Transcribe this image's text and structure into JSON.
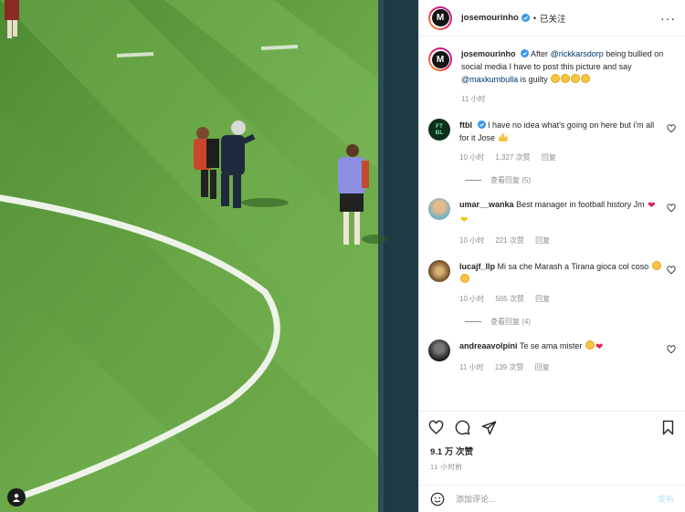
{
  "header": {
    "username": "josemourinho",
    "separator": "•",
    "follow_state": "已关注",
    "more": "···"
  },
  "caption": {
    "username": "josemourinho",
    "text_before": " After ",
    "mention1": "@rickkarsdorp",
    "text_middle": " being bullied on social media I have to post this picture and say ",
    "mention2": "@maxkumbulla",
    "text_after": " is guilty",
    "time": "11 小时"
  },
  "comments": [
    {
      "username": "ftbl",
      "verified": true,
      "avatar_text": "FT BL",
      "text": "I have no idea what's going on here but i'm all for it Jose",
      "time": "10 小时",
      "likes": "1,327 次赞",
      "reply": "回复",
      "view_replies": "查看回复 (5)"
    },
    {
      "username": "umar__wanka",
      "text": "Best manager in football history Jm",
      "time": "10 小时",
      "likes": "221 次赞",
      "reply": "回复"
    },
    {
      "username": "lucajf_llp",
      "text": "Mi sa che Marash a Tirana gioca col coso",
      "time": "10 小时",
      "likes": "505 次赞",
      "reply": "回复",
      "view_replies": "查看回复 (4)"
    },
    {
      "username": "andreaavolpini",
      "text": "Te se ama mister",
      "time": "11 小时",
      "likes": "139 次赞",
      "reply": "回复"
    }
  ],
  "actions": {
    "like_icon": "heart-icon",
    "comment_icon": "comment-icon",
    "share_icon": "share-icon",
    "save_icon": "bookmark-icon",
    "likes_count": "9.1 万 次赞",
    "posted": "11 小时前"
  },
  "composer": {
    "placeholder": "添加评论...",
    "post_label": "发布",
    "emoji_icon": "smiley-icon"
  },
  "colors": {
    "field_green": "#5f9b3d",
    "mention": "#00376b",
    "muted": "#8e8e8e",
    "verified": "#3897f0",
    "post_button_disabled": "#b2dffc"
  }
}
